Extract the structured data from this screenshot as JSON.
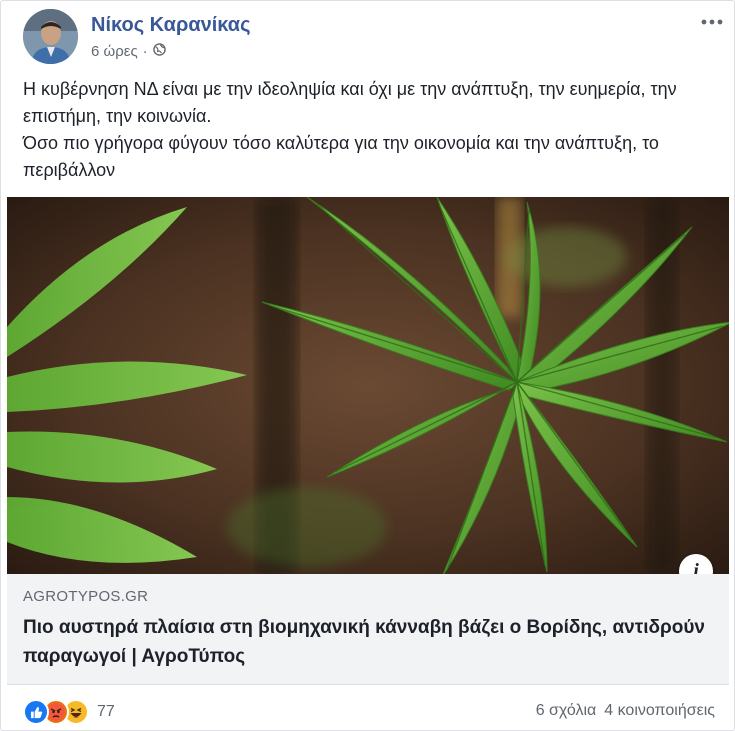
{
  "post": {
    "author": "Νίκος Καρανίκας",
    "time": "6 ώρες",
    "separator": "·",
    "privacy_icon": "globe-icon",
    "more_icon": "more-options-icon",
    "text": [
      "Η κυβέρνηση ΝΔ είναι με την ιδεοληψία και όχι με την ανάπτυξη, την ευημερία, την επιστήμη, την κοινωνία.",
      "Όσο πιο γρήγορα φύγουν τόσο καλύτερα για την οικονομία και την ανάπτυξη, το περιβάλλον"
    ]
  },
  "link_preview": {
    "domain": "AGROTYPOS.GR",
    "title": "Πιο αυστηρά πλαίσια στη βιομηχανική κάνναβη βάζει ο Βορίδης, αντιδρούν παραγωγοί | ΑγροΤύπος",
    "info_icon": "info-icon"
  },
  "reactions": {
    "icons": [
      "like-icon",
      "angry-icon",
      "haha-icon"
    ],
    "count": "77"
  },
  "stats": {
    "comments": "6 σχόλια",
    "shares": "4 κοινοποιήσεις"
  },
  "colors": {
    "author": "#385898",
    "like": "#1877f2",
    "angry": "#e9710f",
    "haha": "#f7b928",
    "leaf": "#4f9a2c"
  }
}
